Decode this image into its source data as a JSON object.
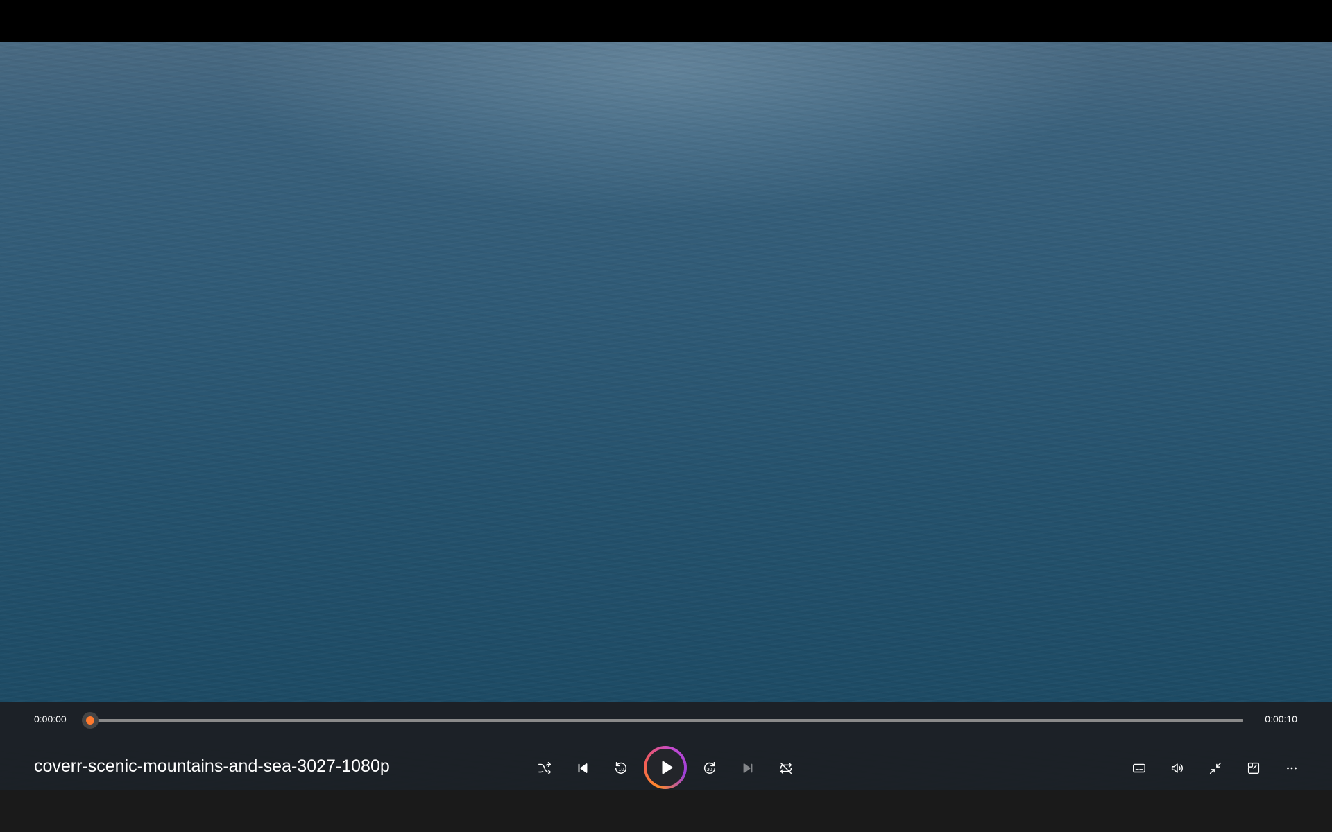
{
  "player": {
    "current_time": "0:00:00",
    "total_time": "0:00:10",
    "progress_percent": 0,
    "title": "coverr-scenic-mountains-and-sea-3027-1080p",
    "accent_color": "#ff7a2e"
  },
  "controls": {
    "center": [
      "shuffle-icon",
      "previous-icon",
      "rewind-10-icon",
      "play-icon",
      "forward-30-icon",
      "next-icon",
      "repeat-icon"
    ],
    "right": [
      "captions-icon",
      "volume-icon",
      "compact-mode-icon",
      "mini-player-icon",
      "more-options-icon"
    ],
    "rewind_label": "10",
    "forward_label": "30"
  }
}
